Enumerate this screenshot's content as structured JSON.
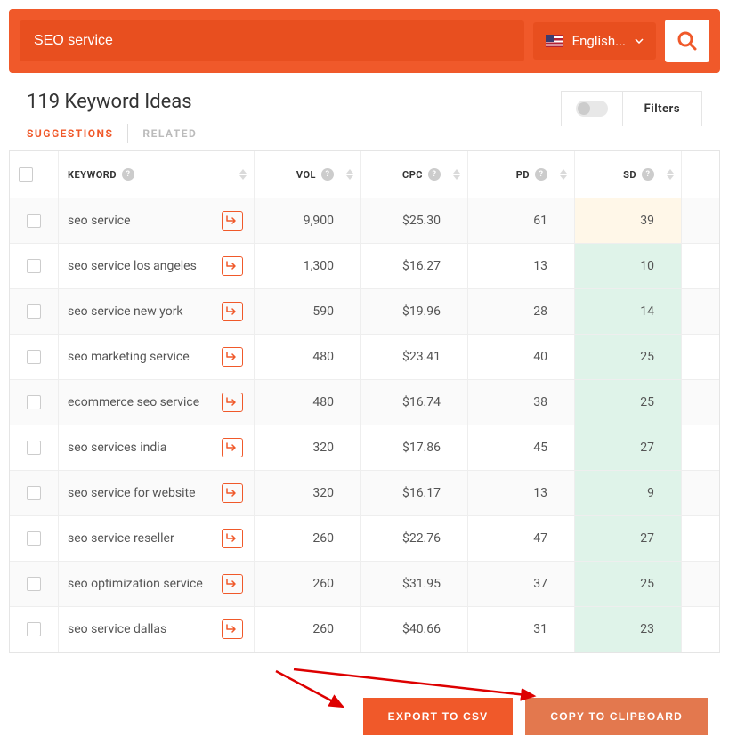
{
  "search": {
    "value": "SEO service",
    "language": "English..."
  },
  "title": "119 Keyword Ideas",
  "tabs": {
    "suggestions": "SUGGESTIONS",
    "related": "RELATED"
  },
  "filters_label": "Filters",
  "headers": {
    "keyword": "KEYWORD",
    "vol": "VOL",
    "cpc": "CPC",
    "pd": "PD",
    "sd": "SD"
  },
  "rows": [
    {
      "keyword": "seo service",
      "vol": "9,900",
      "cpc": "$25.30",
      "pd": "61",
      "sd": "39",
      "sd_class": "sd-low2"
    },
    {
      "keyword": "seo service los angeles",
      "vol": "1,300",
      "cpc": "$16.27",
      "pd": "13",
      "sd": "10",
      "sd_class": "sd-low"
    },
    {
      "keyword": "seo service new york",
      "vol": "590",
      "cpc": "$19.96",
      "pd": "28",
      "sd": "14",
      "sd_class": "sd-low"
    },
    {
      "keyword": "seo marketing service",
      "vol": "480",
      "cpc": "$23.41",
      "pd": "40",
      "sd": "25",
      "sd_class": "sd-low"
    },
    {
      "keyword": "ecommerce seo service",
      "vol": "480",
      "cpc": "$16.74",
      "pd": "38",
      "sd": "25",
      "sd_class": "sd-low"
    },
    {
      "keyword": "seo services india",
      "vol": "320",
      "cpc": "$17.86",
      "pd": "45",
      "sd": "27",
      "sd_class": "sd-low"
    },
    {
      "keyword": "seo service for website",
      "vol": "320",
      "cpc": "$16.17",
      "pd": "13",
      "sd": "9",
      "sd_class": "sd-low"
    },
    {
      "keyword": "seo service reseller",
      "vol": "260",
      "cpc": "$22.76",
      "pd": "47",
      "sd": "27",
      "sd_class": "sd-low"
    },
    {
      "keyword": "seo optimization service",
      "vol": "260",
      "cpc": "$31.95",
      "pd": "37",
      "sd": "25",
      "sd_class": "sd-low"
    },
    {
      "keyword": "seo service dallas",
      "vol": "260",
      "cpc": "$40.66",
      "pd": "31",
      "sd": "23",
      "sd_class": "sd-low"
    }
  ],
  "buttons": {
    "export": "EXPORT TO CSV",
    "copy": "COPY TO CLIPBOARD"
  }
}
